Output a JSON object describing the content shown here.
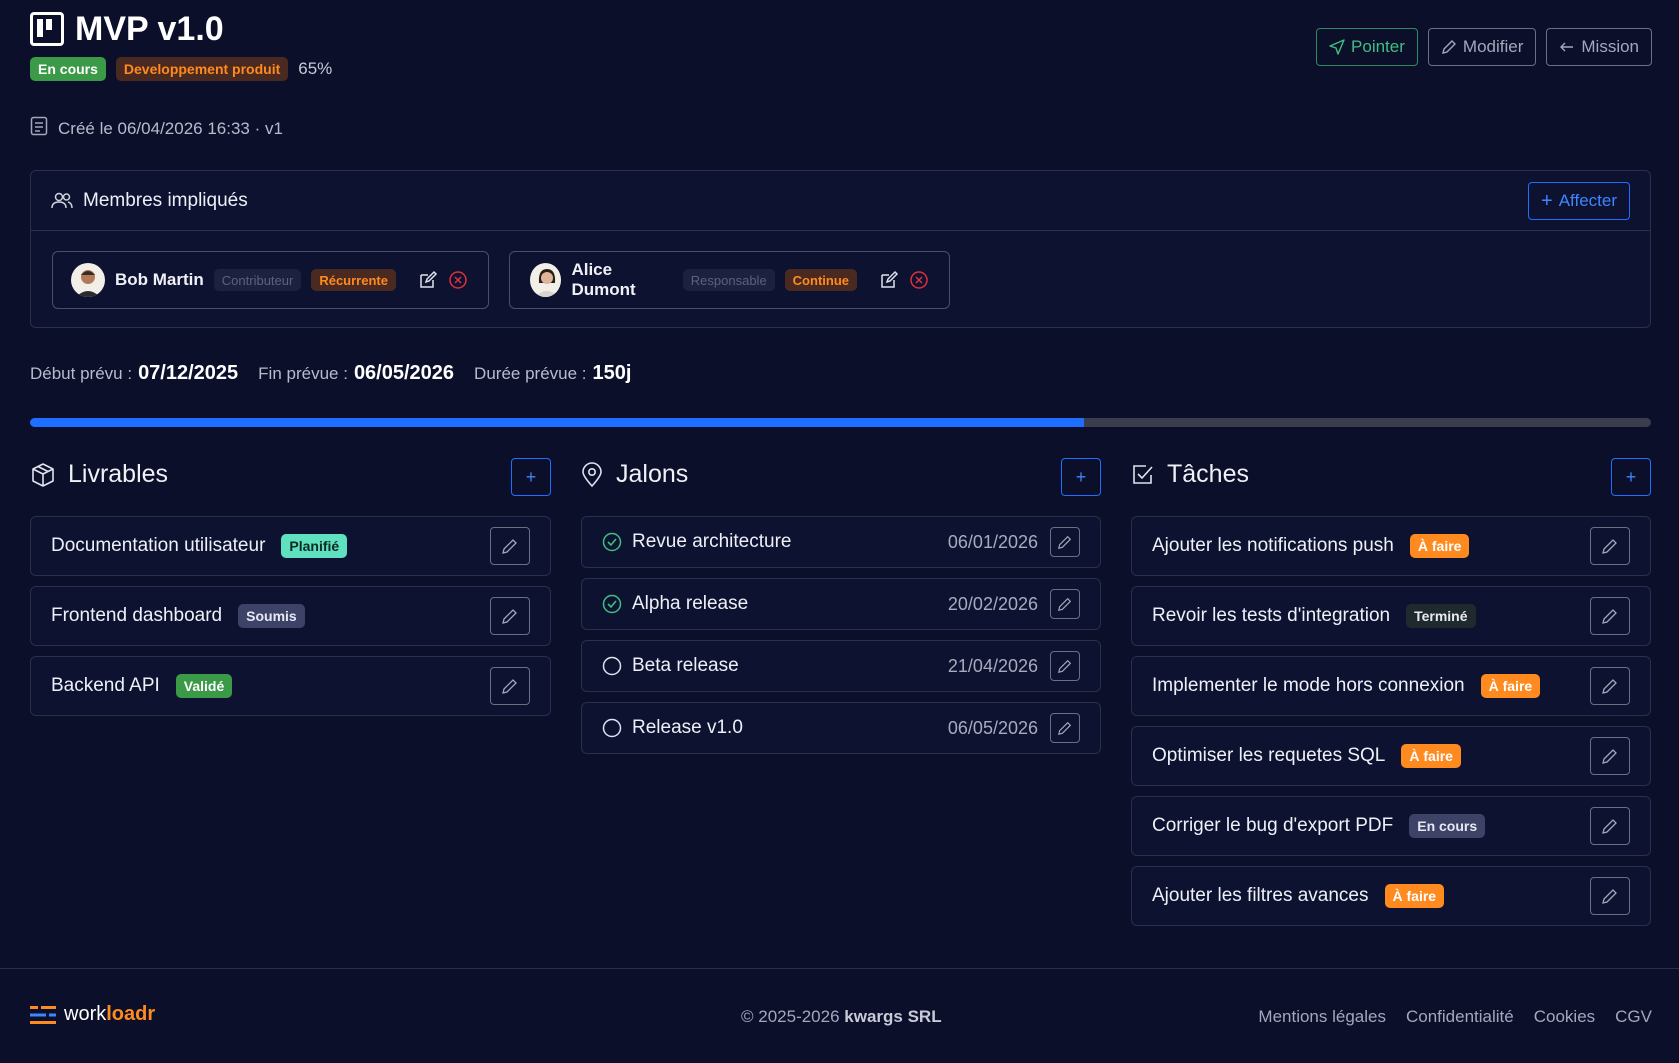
{
  "header": {
    "title": "MVP v1.0",
    "status_badge": "En cours",
    "category_badge": "Developpement produit",
    "progress_label": "65%",
    "created": "Créé le 06/04/2026 16:33 · v1",
    "actions": {
      "pointer": "Pointer",
      "modify": "Modifier",
      "mission": "Mission"
    }
  },
  "members": {
    "title": "Membres impliqués",
    "assign_label": "Affecter",
    "items": [
      {
        "name": "Bob Martin",
        "role": "Contributeur",
        "frequency": "Récurrente"
      },
      {
        "name": "Alice Dumont",
        "role": "Responsable",
        "frequency": "Continue"
      }
    ]
  },
  "schedule": {
    "start_label": "Début prévu :",
    "start_value": "07/12/2025",
    "end_label": "Fin prévue :",
    "end_value": "06/05/2026",
    "duration_label": "Durée prévue :",
    "duration_value": "150j",
    "progress_fraction": 0.65
  },
  "deliverables": {
    "title": "Livrables",
    "items": [
      {
        "name": "Documentation utilisateur",
        "status": "Planifié",
        "status_color": "#5fe0bf",
        "text_color": "#0b2a22"
      },
      {
        "name": "Frontend dashboard",
        "status": "Soumis",
        "status_color": "#3d4267",
        "text_color": "#e8e9f3"
      },
      {
        "name": "Backend API",
        "status": "Validé",
        "status_color": "#3b9a47",
        "text_color": "#ffffff"
      }
    ]
  },
  "milestones": {
    "title": "Jalons",
    "items": [
      {
        "name": "Revue architecture",
        "date": "06/01/2026",
        "done": true
      },
      {
        "name": "Alpha release",
        "date": "20/02/2026",
        "done": true
      },
      {
        "name": "Beta release",
        "date": "21/04/2026",
        "done": false
      },
      {
        "name": "Release v1.0",
        "date": "06/05/2026",
        "done": false
      }
    ]
  },
  "tasks": {
    "title": "Tâches",
    "items": [
      {
        "name": "Ajouter les notifications push",
        "status": "À faire",
        "status_color": "#ff8a1f",
        "text_color": "#ffffff"
      },
      {
        "name": "Revoir les tests d'integration",
        "status": "Terminé",
        "status_color": "#1f2a2e",
        "text_color": "#e8e9f3"
      },
      {
        "name": "Implementer le mode hors connexion",
        "status": "À faire",
        "status_color": "#ff8a1f",
        "text_color": "#ffffff"
      },
      {
        "name": "Optimiser les requetes SQL",
        "status": "À faire",
        "status_color": "#ff8a1f",
        "text_color": "#ffffff"
      },
      {
        "name": "Corriger le bug d'export PDF",
        "status": "En cours",
        "status_color": "#3d4267",
        "text_color": "#e8e9f3"
      },
      {
        "name": "Ajouter les filtres avances",
        "status": "À faire",
        "status_color": "#ff8a1f",
        "text_color": "#ffffff"
      }
    ]
  },
  "footer": {
    "brand_a": "work",
    "brand_b": "loadr",
    "copyright_a": "© 2025-2026 ",
    "copyright_b": "kwargs SRL",
    "links": [
      "Mentions légales",
      "Confidentialité",
      "Cookies",
      "CGV"
    ]
  },
  "colors": {
    "accent": "#1e6fff",
    "background": "#0b0f2a",
    "success": "#3b9a47",
    "warning": "#ff8a1f"
  }
}
